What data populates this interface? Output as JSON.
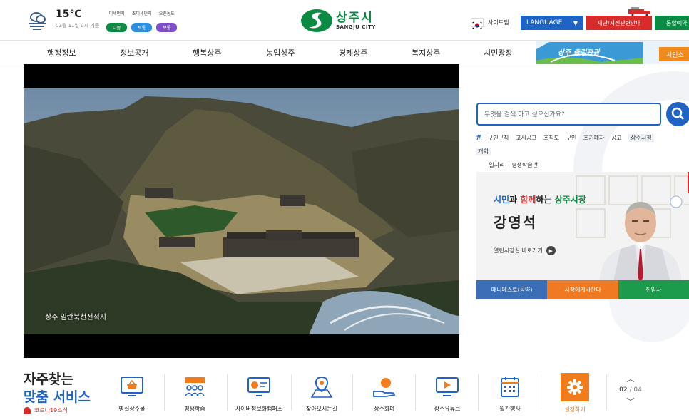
{
  "weather": {
    "temperature": "15℃",
    "date": "03월 11일 0시 기준",
    "icon": "cloud-icon",
    "dust": [
      {
        "label": "미세먼지",
        "status": "나쁨",
        "color": "#0a8a43"
      },
      {
        "label": "초미세먼지",
        "status": "보통",
        "color": "#2b8fe0"
      },
      {
        "label": "오존농도",
        "status": "보통",
        "color": "#7e4fc9"
      }
    ]
  },
  "logo": {
    "ko": "상주시",
    "en": "SANGJU CITY"
  },
  "utility": {
    "sitemap": "사이트맵",
    "language": "LANGUAGE",
    "disaster": "재난/지진관련안내",
    "booking": "통합예약"
  },
  "nav": {
    "items": [
      "행정정보",
      "정보공개",
      "행복상주",
      "농업상주",
      "경제상주",
      "복지상주",
      "시민광장"
    ],
    "banner_text": "상주 출렁관광",
    "banner_button": "시민소"
  },
  "hero": {
    "caption": "상주 임란북천전적지"
  },
  "search": {
    "placeholder": "무엇을 검색 하고 싶으신가요?",
    "hash": "#",
    "tags": [
      "구인구직",
      "고시공고",
      "조직도",
      "구인",
      "조기폐차",
      "공고",
      "상주시청",
      "개회",
      "일자리",
      "평생학습관"
    ]
  },
  "mayor": {
    "headline_1": "시민",
    "headline_2": "과 ",
    "headline_3": "함께",
    "headline_4": "하는 ",
    "headline_5": "상주시장",
    "name": "강영석",
    "link": "열린시장실 바로가기",
    "tabs": [
      {
        "label": "매니페스토(공약)",
        "color": "#3a6fb7"
      },
      {
        "label": "시장에게바란다",
        "color": "#ef7a22"
      },
      {
        "label": "취임사",
        "color": "#1d9b4c"
      }
    ]
  },
  "quick": {
    "title_1": "자주찾는",
    "title_2": "맞춤 서비스",
    "covid": "코로나19소식",
    "items": [
      {
        "label": "명실상주몰",
        "icon": "shopping-basket-icon"
      },
      {
        "label": "평생학습",
        "icon": "lifelong-learning-icon"
      },
      {
        "label": "사이버정보화캠퍼스",
        "icon": "cyber-campus-icon"
      },
      {
        "label": "찾아오시는길",
        "icon": "map-pin-icon"
      },
      {
        "label": "상주화폐",
        "icon": "local-currency-icon"
      },
      {
        "label": "상주유튜브",
        "icon": "youtube-icon"
      },
      {
        "label": "월간행사",
        "icon": "calendar-icon"
      }
    ],
    "settings": "설정하기",
    "page": "02",
    "total": "/ 04"
  }
}
